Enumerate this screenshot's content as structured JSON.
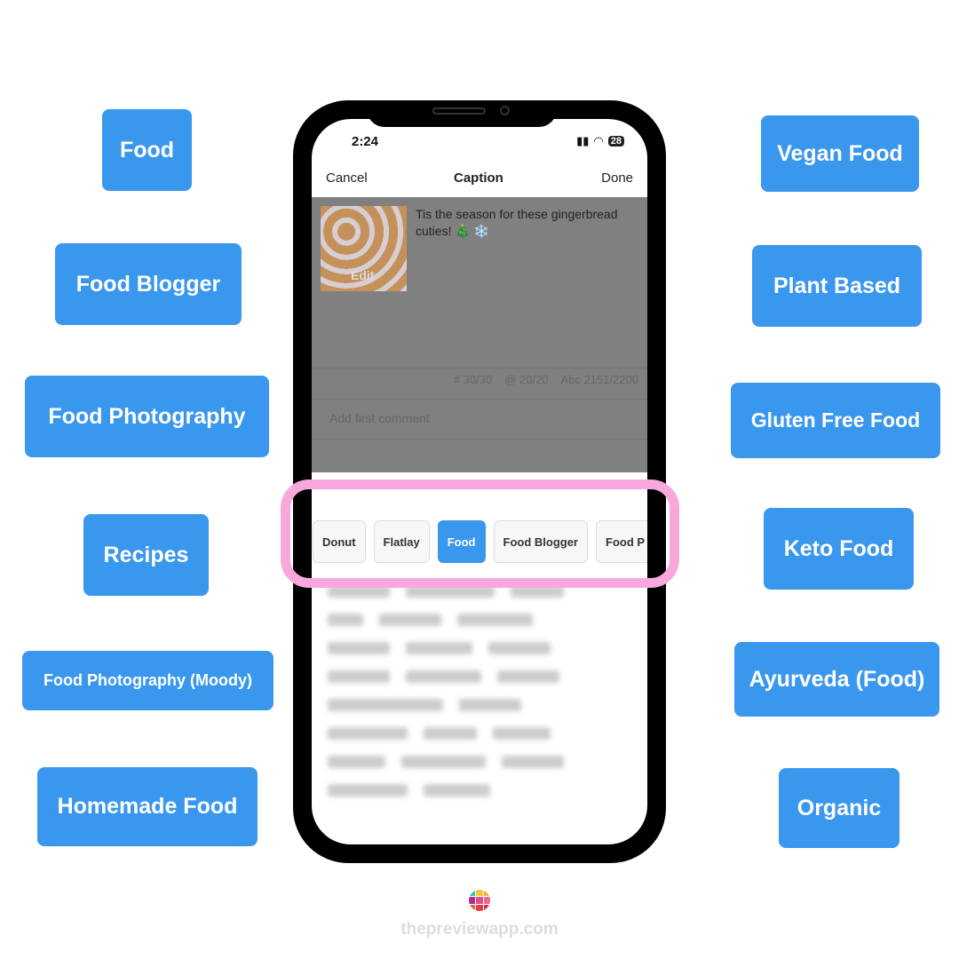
{
  "left_tags": [
    "Food",
    "Food Blogger",
    "Food Photography",
    "Recipes",
    "Food Photography (Moody)",
    "Homemade Food"
  ],
  "right_tags": [
    "Vegan Food",
    "Plant Based",
    "Gluten Free Food",
    "Keto Food",
    "Ayurveda (Food)",
    "Organic"
  ],
  "phone": {
    "time": "2:24",
    "battery": "28",
    "nav": {
      "cancel": "Cancel",
      "title": "Caption",
      "done": "Done"
    },
    "thumb_edit": "Edit",
    "caption": "Tis the season for these gingerbread cuties! 🎄 ❄️",
    "counts": {
      "hashtags": "# 30/30",
      "mentions": "@ 20/20",
      "chars": "Abc 2151/2200"
    },
    "comment_placeholder": "Add first comment",
    "chips": [
      {
        "label": "Donut",
        "active": false
      },
      {
        "label": "Flatlay",
        "active": false
      },
      {
        "label": "Food",
        "active": true
      },
      {
        "label": "Food Blogger",
        "active": false
      },
      {
        "label": "Food P",
        "active": false
      }
    ]
  },
  "colors": {
    "tag": "#3a97ee",
    "highlight": "#f9a8dc"
  },
  "footer": {
    "site": "thepreviewapp.com"
  }
}
